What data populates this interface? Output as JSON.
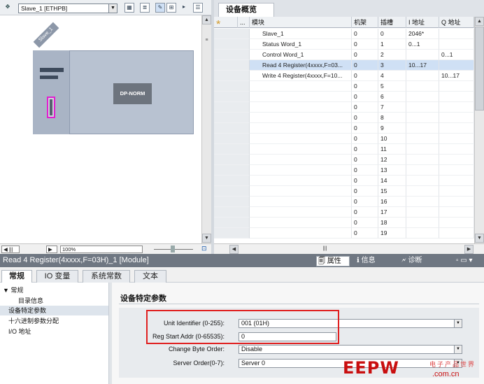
{
  "topLeft": {
    "device_select": "Slave_1 [ETHPB]",
    "zoom": "100%"
  },
  "device": {
    "name": "Slave_1",
    "module_label": "DP-NORM"
  },
  "overview": {
    "tab_label": "设备概览",
    "headers": [
      "",
      "...",
      "模块",
      "机架",
      "插槽",
      "I 地址",
      "Q 地址"
    ],
    "rows": [
      {
        "module": "Slave_1",
        "rack": "0",
        "slot": "0",
        "i": "2046*",
        "q": ""
      },
      {
        "module": "Status Word_1",
        "rack": "0",
        "slot": "1",
        "i": "0...1",
        "q": ""
      },
      {
        "module": "Control Word_1",
        "rack": "0",
        "slot": "2",
        "i": "",
        "q": "0...1"
      },
      {
        "module": "Read 4 Register(4xxxx,F=03...",
        "rack": "0",
        "slot": "3",
        "i": "10...17",
        "q": "",
        "selected": true
      },
      {
        "module": "Write 4 Register(4xxxx,F=10...",
        "rack": "0",
        "slot": "4",
        "i": "",
        "q": "10...17"
      },
      {
        "module": "",
        "rack": "0",
        "slot": "5",
        "i": "",
        "q": ""
      },
      {
        "module": "",
        "rack": "0",
        "slot": "6",
        "i": "",
        "q": ""
      },
      {
        "module": "",
        "rack": "0",
        "slot": "7",
        "i": "",
        "q": ""
      },
      {
        "module": "",
        "rack": "0",
        "slot": "8",
        "i": "",
        "q": ""
      },
      {
        "module": "",
        "rack": "0",
        "slot": "9",
        "i": "",
        "q": ""
      },
      {
        "module": "",
        "rack": "0",
        "slot": "10",
        "i": "",
        "q": ""
      },
      {
        "module": "",
        "rack": "0",
        "slot": "11",
        "i": "",
        "q": ""
      },
      {
        "module": "",
        "rack": "0",
        "slot": "12",
        "i": "",
        "q": ""
      },
      {
        "module": "",
        "rack": "0",
        "slot": "13",
        "i": "",
        "q": ""
      },
      {
        "module": "",
        "rack": "0",
        "slot": "14",
        "i": "",
        "q": ""
      },
      {
        "module": "",
        "rack": "0",
        "slot": "15",
        "i": "",
        "q": ""
      },
      {
        "module": "",
        "rack": "0",
        "slot": "16",
        "i": "",
        "q": ""
      },
      {
        "module": "",
        "rack": "0",
        "slot": "17",
        "i": "",
        "q": ""
      },
      {
        "module": "",
        "rack": "0",
        "slot": "18",
        "i": "",
        "q": ""
      },
      {
        "module": "",
        "rack": "0",
        "slot": "19",
        "i": "",
        "q": ""
      }
    ]
  },
  "inspector": {
    "title": "Read 4 Register(4xxxx,F=03H)_1 [Module]",
    "properties": "属性",
    "info": "信息",
    "diagnostics": "诊断",
    "tabs": [
      "常规",
      "IO 变量",
      "系统常数",
      "文本"
    ],
    "tree": [
      "▼ 常规",
      "目录信息",
      "设备特定参数",
      "十六进制参数分配",
      "I/O 地址"
    ],
    "section_title": "设备特定参数",
    "fields": [
      {
        "label": "Unit Identifier (0-255):",
        "value": "001 (01H)",
        "dropdown": true
      },
      {
        "label": "Reg Start Addr (0-65535):",
        "value": "0",
        "dropdown": false
      },
      {
        "label": "Change Byte Order:",
        "value": "Disable",
        "dropdown": true
      },
      {
        "label": "Server Order(0-7):",
        "value": "Server 0",
        "dropdown": true
      }
    ]
  },
  "watermark": {
    "brand": "EEPW",
    "cn": "电子产品世界",
    "domain": ".com.cn"
  }
}
